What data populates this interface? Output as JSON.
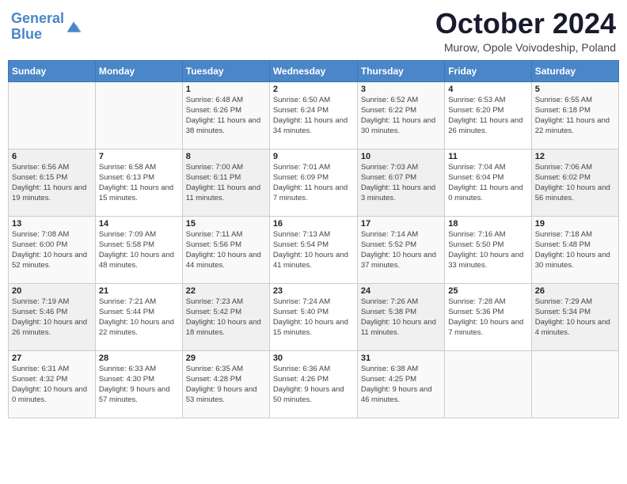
{
  "logo": {
    "line1": "General",
    "line2": "Blue"
  },
  "title": "October 2024",
  "subtitle": "Murow, Opole Voivodeship, Poland",
  "days_of_week": [
    "Sunday",
    "Monday",
    "Tuesday",
    "Wednesday",
    "Thursday",
    "Friday",
    "Saturday"
  ],
  "weeks": [
    [
      {
        "day": "",
        "info": ""
      },
      {
        "day": "",
        "info": ""
      },
      {
        "day": "1",
        "info": "Sunrise: 6:48 AM\nSunset: 6:26 PM\nDaylight: 11 hours and 38 minutes."
      },
      {
        "day": "2",
        "info": "Sunrise: 6:50 AM\nSunset: 6:24 PM\nDaylight: 11 hours and 34 minutes."
      },
      {
        "day": "3",
        "info": "Sunrise: 6:52 AM\nSunset: 6:22 PM\nDaylight: 11 hours and 30 minutes."
      },
      {
        "day": "4",
        "info": "Sunrise: 6:53 AM\nSunset: 6:20 PM\nDaylight: 11 hours and 26 minutes."
      },
      {
        "day": "5",
        "info": "Sunrise: 6:55 AM\nSunset: 6:18 PM\nDaylight: 11 hours and 22 minutes."
      }
    ],
    [
      {
        "day": "6",
        "info": "Sunrise: 6:56 AM\nSunset: 6:15 PM\nDaylight: 11 hours and 19 minutes."
      },
      {
        "day": "7",
        "info": "Sunrise: 6:58 AM\nSunset: 6:13 PM\nDaylight: 11 hours and 15 minutes."
      },
      {
        "day": "8",
        "info": "Sunrise: 7:00 AM\nSunset: 6:11 PM\nDaylight: 11 hours and 11 minutes."
      },
      {
        "day": "9",
        "info": "Sunrise: 7:01 AM\nSunset: 6:09 PM\nDaylight: 11 hours and 7 minutes."
      },
      {
        "day": "10",
        "info": "Sunrise: 7:03 AM\nSunset: 6:07 PM\nDaylight: 11 hours and 3 minutes."
      },
      {
        "day": "11",
        "info": "Sunrise: 7:04 AM\nSunset: 6:04 PM\nDaylight: 11 hours and 0 minutes."
      },
      {
        "day": "12",
        "info": "Sunrise: 7:06 AM\nSunset: 6:02 PM\nDaylight: 10 hours and 56 minutes."
      }
    ],
    [
      {
        "day": "13",
        "info": "Sunrise: 7:08 AM\nSunset: 6:00 PM\nDaylight: 10 hours and 52 minutes."
      },
      {
        "day": "14",
        "info": "Sunrise: 7:09 AM\nSunset: 5:58 PM\nDaylight: 10 hours and 48 minutes."
      },
      {
        "day": "15",
        "info": "Sunrise: 7:11 AM\nSunset: 5:56 PM\nDaylight: 10 hours and 44 minutes."
      },
      {
        "day": "16",
        "info": "Sunrise: 7:13 AM\nSunset: 5:54 PM\nDaylight: 10 hours and 41 minutes."
      },
      {
        "day": "17",
        "info": "Sunrise: 7:14 AM\nSunset: 5:52 PM\nDaylight: 10 hours and 37 minutes."
      },
      {
        "day": "18",
        "info": "Sunrise: 7:16 AM\nSunset: 5:50 PM\nDaylight: 10 hours and 33 minutes."
      },
      {
        "day": "19",
        "info": "Sunrise: 7:18 AM\nSunset: 5:48 PM\nDaylight: 10 hours and 30 minutes."
      }
    ],
    [
      {
        "day": "20",
        "info": "Sunrise: 7:19 AM\nSunset: 5:46 PM\nDaylight: 10 hours and 26 minutes."
      },
      {
        "day": "21",
        "info": "Sunrise: 7:21 AM\nSunset: 5:44 PM\nDaylight: 10 hours and 22 minutes."
      },
      {
        "day": "22",
        "info": "Sunrise: 7:23 AM\nSunset: 5:42 PM\nDaylight: 10 hours and 18 minutes."
      },
      {
        "day": "23",
        "info": "Sunrise: 7:24 AM\nSunset: 5:40 PM\nDaylight: 10 hours and 15 minutes."
      },
      {
        "day": "24",
        "info": "Sunrise: 7:26 AM\nSunset: 5:38 PM\nDaylight: 10 hours and 11 minutes."
      },
      {
        "day": "25",
        "info": "Sunrise: 7:28 AM\nSunset: 5:36 PM\nDaylight: 10 hours and 7 minutes."
      },
      {
        "day": "26",
        "info": "Sunrise: 7:29 AM\nSunset: 5:34 PM\nDaylight: 10 hours and 4 minutes."
      }
    ],
    [
      {
        "day": "27",
        "info": "Sunrise: 6:31 AM\nSunset: 4:32 PM\nDaylight: 10 hours and 0 minutes."
      },
      {
        "day": "28",
        "info": "Sunrise: 6:33 AM\nSunset: 4:30 PM\nDaylight: 9 hours and 57 minutes."
      },
      {
        "day": "29",
        "info": "Sunrise: 6:35 AM\nSunset: 4:28 PM\nDaylight: 9 hours and 53 minutes."
      },
      {
        "day": "30",
        "info": "Sunrise: 6:36 AM\nSunset: 4:26 PM\nDaylight: 9 hours and 50 minutes."
      },
      {
        "day": "31",
        "info": "Sunrise: 6:38 AM\nSunset: 4:25 PM\nDaylight: 9 hours and 46 minutes."
      },
      {
        "day": "",
        "info": ""
      },
      {
        "day": "",
        "info": ""
      }
    ]
  ]
}
